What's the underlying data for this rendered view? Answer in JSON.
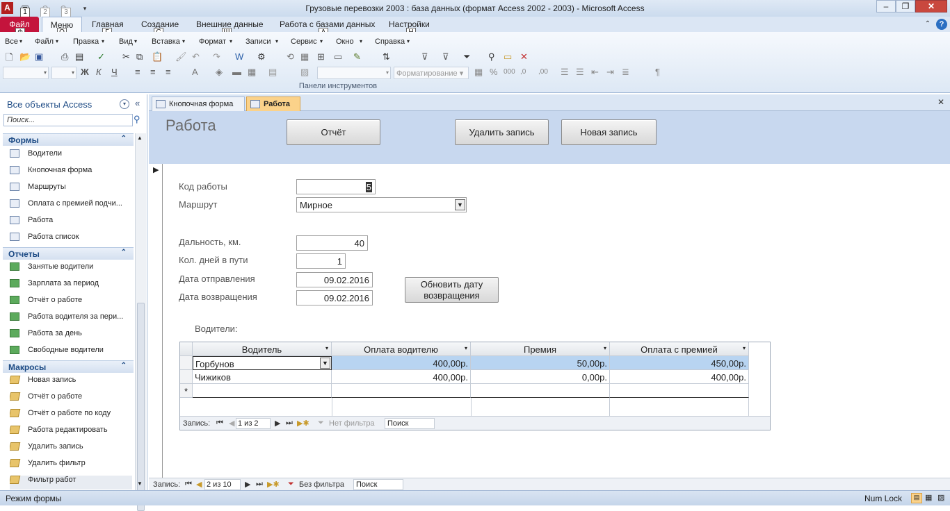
{
  "title": "Грузовые перевозки 2003 : база данных (формат Access 2002 - 2003)  -  Microsoft Access",
  "quick_access_keytips": [
    "1",
    "2",
    "3"
  ],
  "ribbon_tabs": [
    {
      "label": "Файл",
      "keytip": "Ф"
    },
    {
      "label": "Меню",
      "keytip": "Q"
    },
    {
      "label": "Главная",
      "keytip": "Г"
    },
    {
      "label": "Создание",
      "keytip": "С"
    },
    {
      "label": "Внешние данные",
      "keytip": "Ш"
    },
    {
      "label": "Работа с базами данных",
      "keytip": "А"
    },
    {
      "label": "Настройки",
      "keytip": "Н"
    }
  ],
  "menu_items": [
    "Все",
    "Файл",
    "Правка",
    "Вид",
    "Вставка",
    "Формат",
    "Записи",
    "Сервис",
    "Окно",
    "Справка"
  ],
  "formatting_dropdown": "Форматирование",
  "toolbar_group_label": "Панели инструментов",
  "nav": {
    "header": "Все объекты Access",
    "search_placeholder": "Поиск...",
    "groups": [
      {
        "title": "Формы",
        "kind": "form",
        "items": [
          "Водители",
          "Кнопочная форма",
          "Маршруты",
          "Оплата с премией подчи...",
          "Работа",
          "Работа список"
        ]
      },
      {
        "title": "Отчеты",
        "kind": "report",
        "items": [
          "Занятые водители",
          "Зарплата за период",
          "Отчёт о работе",
          "Работа водителя за пери...",
          "Работа за день",
          "Свободные водители"
        ]
      },
      {
        "title": "Макросы",
        "kind": "macro",
        "items": [
          "Новая запись",
          "Отчёт о работе",
          "Отчёт о работе по коду",
          "Работа редактировать",
          "Удалить запись",
          "Удалить фильтр",
          "Фильтр работ"
        ]
      }
    ]
  },
  "doc_tabs": [
    "Кнопочная форма",
    "Работа"
  ],
  "form": {
    "title": "Работа",
    "buttons": {
      "report": "Отчёт",
      "delete": "Удалить запись",
      "new": "Новая запись",
      "update_date": "Обновить дату возвращения"
    },
    "fields": {
      "code_label": "Код работы",
      "code_value": "5",
      "route_label": "Маршрут",
      "route_value": "Мирное",
      "distance_label": "Дальность, км.",
      "distance_value": "40",
      "days_label": "Кол. дней в пути",
      "days_value": "1",
      "depart_label": "Дата отправления",
      "depart_value": "09.02.2016",
      "return_label": "Дата возвращения",
      "return_value": "09.02.2016"
    },
    "drivers_label": "Водители:",
    "drivers_table": {
      "columns": [
        "Водитель",
        "Оплата водителю",
        "Премия",
        "Оплата с премией"
      ],
      "rows": [
        [
          "Горбунов",
          "400,00р.",
          "50,00р.",
          "450,00р."
        ],
        [
          "Чижиков",
          "400,00р.",
          "0,00р.",
          "400,00р."
        ]
      ],
      "new_row_marker": "*"
    },
    "sub_nav": {
      "label": "Запись:",
      "position": "1 из 2",
      "filter": "Нет фильтра",
      "search": "Поиск"
    },
    "main_nav": {
      "label": "Запись:",
      "position": "2 из 10",
      "filter": "Без фильтра",
      "search": "Поиск"
    }
  },
  "status": {
    "left": "Режим формы",
    "right": "Num Lock"
  }
}
